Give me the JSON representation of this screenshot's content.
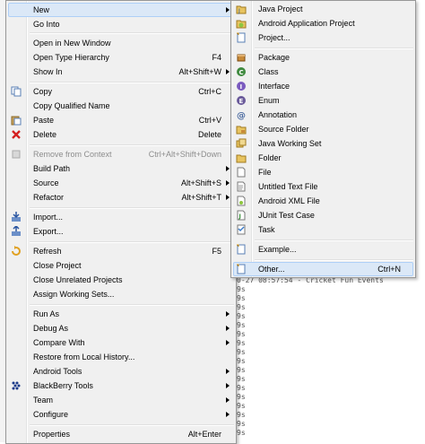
{
  "context_menu": {
    "items": [
      {
        "label": "New",
        "accel": "",
        "submenu": true,
        "icon": "none"
      },
      {
        "label": "Go Into",
        "accel": "",
        "icon": "none"
      },
      {
        "label": "Open in New Window",
        "accel": "",
        "icon": "none"
      },
      {
        "label": "Open Type Hierarchy",
        "accel": "F4",
        "icon": "none"
      },
      {
        "label": "Show In",
        "accel": "Alt+Shift+W",
        "submenu": true,
        "icon": "none"
      },
      {
        "label": "Copy",
        "accel": "Ctrl+C",
        "icon": "copy-icon"
      },
      {
        "label": "Copy Qualified Name",
        "accel": "",
        "icon": "none"
      },
      {
        "label": "Paste",
        "accel": "Ctrl+V",
        "icon": "paste-icon"
      },
      {
        "label": "Delete",
        "accel": "Delete",
        "icon": "delete-icon"
      },
      {
        "label": "Remove from Context",
        "accel": "Ctrl+Alt+Shift+Down",
        "disabled": true,
        "icon": "remove-context-icon"
      },
      {
        "label": "Build Path",
        "accel": "",
        "submenu": true,
        "icon": "none"
      },
      {
        "label": "Source",
        "accel": "Alt+Shift+S",
        "submenu": true,
        "icon": "none"
      },
      {
        "label": "Refactor",
        "accel": "Alt+Shift+T",
        "submenu": true,
        "icon": "none"
      },
      {
        "label": "Import...",
        "accel": "",
        "icon": "import-icon"
      },
      {
        "label": "Export...",
        "accel": "",
        "icon": "export-icon"
      },
      {
        "label": "Refresh",
        "accel": "F5",
        "icon": "refresh-icon"
      },
      {
        "label": "Close Project",
        "accel": "",
        "icon": "none"
      },
      {
        "label": "Close Unrelated Projects",
        "accel": "",
        "icon": "none"
      },
      {
        "label": "Assign Working Sets...",
        "accel": "",
        "icon": "none"
      },
      {
        "label": "Run As",
        "accel": "",
        "submenu": true,
        "icon": "none"
      },
      {
        "label": "Debug As",
        "accel": "",
        "submenu": true,
        "icon": "none"
      },
      {
        "label": "Compare With",
        "accel": "",
        "submenu": true,
        "icon": "none"
      },
      {
        "label": "Restore from Local History...",
        "accel": "",
        "icon": "none"
      },
      {
        "label": "Android Tools",
        "accel": "",
        "submenu": true,
        "icon": "none"
      },
      {
        "label": "BlackBerry Tools",
        "accel": "",
        "submenu": true,
        "icon": "blackberry-icon"
      },
      {
        "label": "Team",
        "accel": "",
        "submenu": true,
        "icon": "none"
      },
      {
        "label": "Configure",
        "accel": "",
        "submenu": true,
        "icon": "none"
      },
      {
        "label": "Properties",
        "accel": "Alt+Enter",
        "icon": "none"
      }
    ]
  },
  "new_submenu": {
    "items": [
      {
        "label": "Java Project",
        "accel": "",
        "icon": "java-project-icon"
      },
      {
        "label": "Android Application Project",
        "accel": "",
        "icon": "android-project-icon"
      },
      {
        "label": "Project...",
        "accel": "",
        "icon": "project-icon"
      },
      {
        "label": "Package",
        "accel": "",
        "icon": "package-icon"
      },
      {
        "label": "Class",
        "accel": "",
        "icon": "class-icon"
      },
      {
        "label": "Interface",
        "accel": "",
        "icon": "interface-icon"
      },
      {
        "label": "Enum",
        "accel": "",
        "icon": "enum-icon"
      },
      {
        "label": "Annotation",
        "accel": "",
        "icon": "annotation-icon"
      },
      {
        "label": "Source Folder",
        "accel": "",
        "icon": "source-folder-icon"
      },
      {
        "label": "Java Working Set",
        "accel": "",
        "icon": "working-set-icon"
      },
      {
        "label": "Folder",
        "accel": "",
        "icon": "folder-icon"
      },
      {
        "label": "File",
        "accel": "",
        "icon": "file-icon"
      },
      {
        "label": "Untitled Text File",
        "accel": "",
        "icon": "text-file-icon"
      },
      {
        "label": "Android XML File",
        "accel": "",
        "icon": "android-xml-icon"
      },
      {
        "label": "JUnit Test Case",
        "accel": "",
        "icon": "junit-icon"
      },
      {
        "label": "Task",
        "accel": "",
        "icon": "task-icon"
      },
      {
        "label": "Example...",
        "accel": "",
        "icon": "example-icon"
      },
      {
        "label": "Other...",
        "accel": "Ctrl+N",
        "icon": "other-icon"
      }
    ]
  },
  "console_lines": [
    "0-27 08:57:54 - Cricket Fun Events",
    "9s",
    "9s",
    "9s",
    "9s",
    "9s",
    "9s",
    "9s",
    "9s",
    "9s",
    "9s",
    "9s",
    "9s",
    "9s",
    "9s",
    "9s",
    "9s",
    "9s"
  ],
  "colors": {
    "menu_bg": "#f0f0f0",
    "highlight": "#dbe8f7",
    "highlight_border": "#aecff7",
    "disabled_text": "#8d8d8d"
  }
}
